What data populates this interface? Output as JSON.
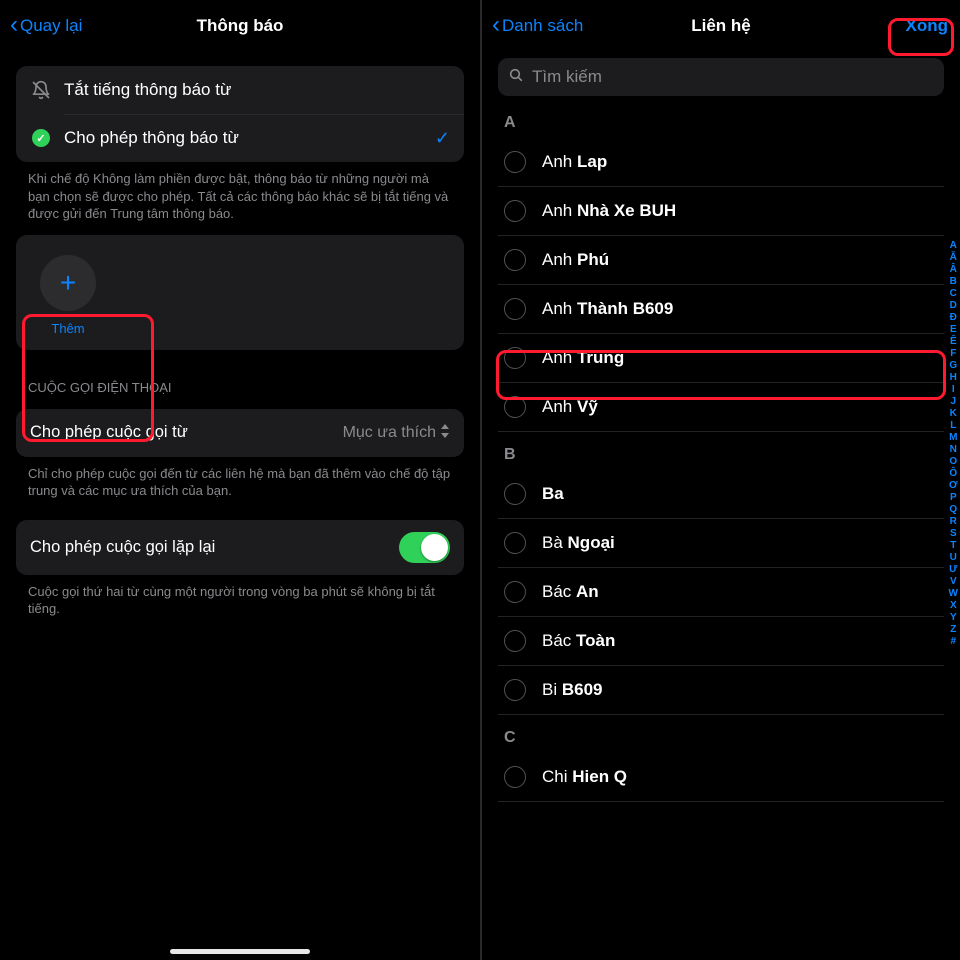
{
  "left": {
    "nav": {
      "back": "Quay lại",
      "title": "Thông báo"
    },
    "options": {
      "silence": "Tắt tiếng thông báo từ",
      "allow": "Cho phép thông báo từ"
    },
    "options_footer": "Khi chế độ Không làm phiền được bật, thông báo từ những người mà bạn chọn sẽ được cho phép. Tất cả các thông báo khác sẽ bị tắt tiếng và được gửi đến Trung tâm thông báo.",
    "add_label": "Thêm",
    "calls_header": "CUỘC GỌI ĐIỆN THOẠI",
    "calls_from": {
      "label": "Cho phép cuộc gọi từ",
      "value": "Mục ưa thích"
    },
    "calls_footer": "Chỉ cho phép cuộc gọi đến từ các liên hệ mà bạn đã thêm vào chế độ tập trung và các mục ưa thích của bạn.",
    "repeat_calls": "Cho phép cuộc gọi lặp lại",
    "repeat_footer": "Cuộc gọi thứ hai từ cùng một người trong vòng ba phút sẽ không bị tắt tiếng."
  },
  "right": {
    "nav": {
      "back": "Danh sách",
      "title": "Liên hệ",
      "done": "Xong"
    },
    "search_placeholder": "Tìm kiếm",
    "groups": [
      {
        "letter": "A",
        "contacts": [
          {
            "first": "Anh",
            "last": "Lap"
          },
          {
            "first": "Anh",
            "last": "Nhà Xe BUH"
          },
          {
            "first": "Anh",
            "last": "Phú"
          },
          {
            "first": "Anh",
            "last": "Thành B609"
          },
          {
            "first": "Anh",
            "last": "Trung"
          },
          {
            "first": "Anh",
            "last": "Vỹ"
          }
        ]
      },
      {
        "letter": "B",
        "contacts": [
          {
            "first": "",
            "last": "Ba"
          },
          {
            "first": "Bà",
            "last": "Ngoại"
          },
          {
            "first": "Bác",
            "last": "An"
          },
          {
            "first": "Bác",
            "last": "Toàn"
          },
          {
            "first": "Bi",
            "last": "B609"
          }
        ]
      },
      {
        "letter": "C",
        "contacts": [
          {
            "first": "Chi",
            "last": "Hien Q"
          }
        ]
      }
    ],
    "index": [
      "A",
      "Ă",
      "Â",
      "B",
      "C",
      "D",
      "Đ",
      "E",
      "Ê",
      "F",
      "G",
      "H",
      "I",
      "J",
      "K",
      "L",
      "M",
      "N",
      "O",
      "Ô",
      "Ơ",
      "P",
      "Q",
      "R",
      "S",
      "T",
      "U",
      "Ư",
      "V",
      "W",
      "X",
      "Y",
      "Z",
      "#"
    ]
  }
}
